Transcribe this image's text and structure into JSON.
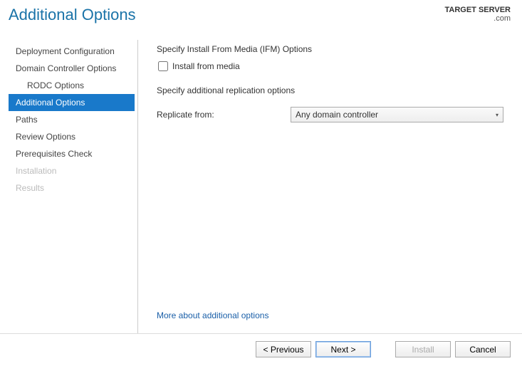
{
  "header": {
    "title": "Additional Options",
    "target_label": "TARGET SERVER",
    "target_value": ".com"
  },
  "sidebar": {
    "items": [
      {
        "label": "Deployment Configuration",
        "indent": false,
        "active": false,
        "disabled": false
      },
      {
        "label": "Domain Controller Options",
        "indent": false,
        "active": false,
        "disabled": false
      },
      {
        "label": "RODC Options",
        "indent": true,
        "active": false,
        "disabled": false
      },
      {
        "label": "Additional Options",
        "indent": false,
        "active": true,
        "disabled": false
      },
      {
        "label": "Paths",
        "indent": false,
        "active": false,
        "disabled": false
      },
      {
        "label": "Review Options",
        "indent": false,
        "active": false,
        "disabled": false
      },
      {
        "label": "Prerequisites Check",
        "indent": false,
        "active": false,
        "disabled": false
      },
      {
        "label": "Installation",
        "indent": false,
        "active": false,
        "disabled": true
      },
      {
        "label": "Results",
        "indent": false,
        "active": false,
        "disabled": true
      }
    ]
  },
  "main": {
    "ifm_heading": "Specify Install From Media (IFM) Options",
    "ifm_checkbox_label": "Install from media",
    "ifm_checked": false,
    "rep_heading": "Specify additional replication options",
    "replicate_label": "Replicate from:",
    "replicate_value": "Any domain controller",
    "help_link": "More about additional options"
  },
  "footer": {
    "previous": "< Previous",
    "next": "Next >",
    "install": "Install",
    "cancel": "Cancel"
  }
}
